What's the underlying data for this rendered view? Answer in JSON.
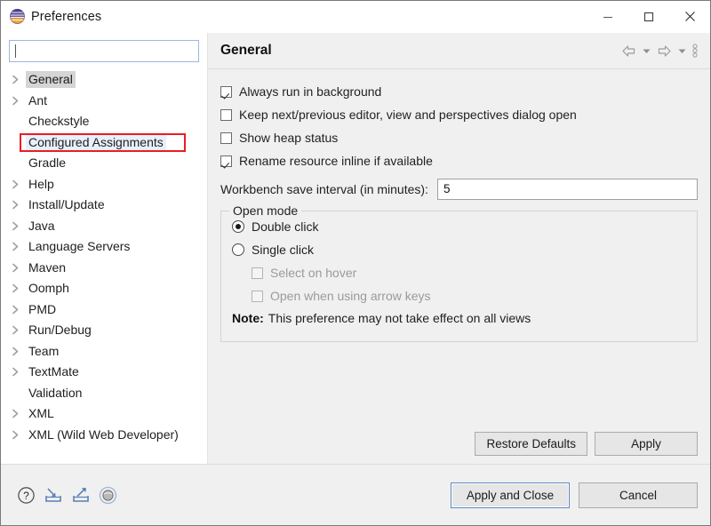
{
  "window": {
    "title": "Preferences",
    "icon": "eclipse-icon",
    "controls": {
      "minimize": "minimize-icon",
      "maximize": "maximize-icon",
      "close": "close-icon"
    }
  },
  "sidebar": {
    "filter": {
      "value": "",
      "placeholder": ""
    },
    "items": [
      {
        "label": "General",
        "expandable": true,
        "selected": true,
        "marked": false
      },
      {
        "label": "Ant",
        "expandable": true,
        "selected": false,
        "marked": false
      },
      {
        "label": "Checkstyle",
        "expandable": false,
        "selected": false,
        "marked": false
      },
      {
        "label": "Configured Assignments",
        "expandable": false,
        "selected": false,
        "marked": true
      },
      {
        "label": "Gradle",
        "expandable": false,
        "selected": false,
        "marked": false
      },
      {
        "label": "Help",
        "expandable": true,
        "selected": false,
        "marked": false
      },
      {
        "label": "Install/Update",
        "expandable": true,
        "selected": false,
        "marked": false
      },
      {
        "label": "Java",
        "expandable": true,
        "selected": false,
        "marked": false
      },
      {
        "label": "Language Servers",
        "expandable": true,
        "selected": false,
        "marked": false
      },
      {
        "label": "Maven",
        "expandable": true,
        "selected": false,
        "marked": false
      },
      {
        "label": "Oomph",
        "expandable": true,
        "selected": false,
        "marked": false
      },
      {
        "label": "PMD",
        "expandable": true,
        "selected": false,
        "marked": false
      },
      {
        "label": "Run/Debug",
        "expandable": true,
        "selected": false,
        "marked": false
      },
      {
        "label": "Team",
        "expandable": true,
        "selected": false,
        "marked": false
      },
      {
        "label": "TextMate",
        "expandable": true,
        "selected": false,
        "marked": false
      },
      {
        "label": "Validation",
        "expandable": false,
        "selected": false,
        "marked": false
      },
      {
        "label": "XML",
        "expandable": true,
        "selected": false,
        "marked": false
      },
      {
        "label": "XML (Wild Web Developer)",
        "expandable": true,
        "selected": false,
        "marked": false
      }
    ]
  },
  "page": {
    "title": "General",
    "toolbar": {
      "back": "back-arrow-icon",
      "back_menu": "chevron-down-icon",
      "forward": "forward-arrow-icon",
      "forward_menu": "chevron-down-icon",
      "menu": "vertical-dots-icon"
    },
    "checkboxes": [
      {
        "label": "Always run in background",
        "checked": true,
        "enabled": true
      },
      {
        "label": "Keep next/previous editor, view and perspectives dialog open",
        "checked": false,
        "enabled": true
      },
      {
        "label": "Show heap status",
        "checked": false,
        "enabled": true
      },
      {
        "label": "Rename resource inline if available",
        "checked": true,
        "enabled": true
      }
    ],
    "save_interval": {
      "label": "Workbench save interval (in minutes):",
      "value": "5"
    },
    "open_mode": {
      "title": "Open mode",
      "radios": [
        {
          "label": "Double click",
          "selected": true
        },
        {
          "label": "Single click",
          "selected": false
        }
      ],
      "sub_checkboxes": [
        {
          "label": "Select on hover",
          "checked": false,
          "enabled": false
        },
        {
          "label": "Open when using arrow keys",
          "checked": false,
          "enabled": false
        }
      ],
      "note_prefix": "Note:",
      "note_text": "This preference may not take effect on all views"
    },
    "buttons": {
      "restore_defaults": "Restore Defaults",
      "apply": "Apply"
    }
  },
  "footer": {
    "icons": [
      {
        "name": "help-icon"
      },
      {
        "name": "import-icon"
      },
      {
        "name": "export-icon"
      },
      {
        "name": "oomph-recorder-icon"
      }
    ],
    "buttons": {
      "apply_and_close": "Apply and Close",
      "cancel": "Cancel"
    }
  },
  "colors": {
    "marker": "#ec1c24",
    "selection": "#d5d5d5",
    "marked_bg": "#e8f0fb",
    "focus_border": "#9bb7e0",
    "window_bg": "#f0f0f0"
  }
}
